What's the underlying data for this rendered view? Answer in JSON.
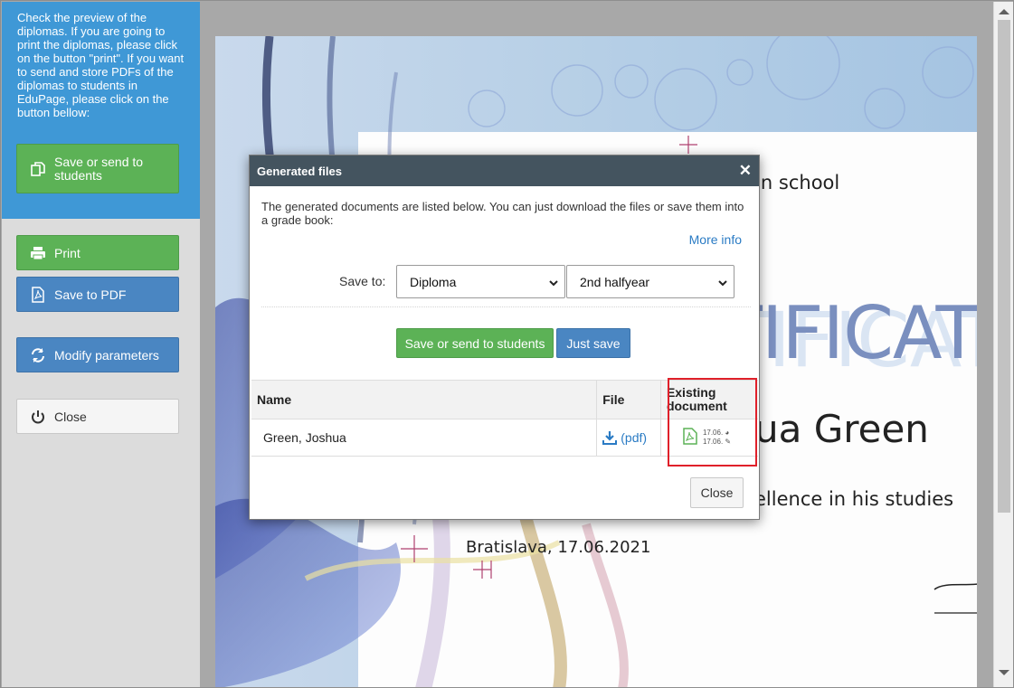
{
  "sidebar": {
    "instructions": "Check the preview of the diplomas. If you are going to print the diplomas, please click on the button \"print\". If you want to send and store PDFs of the diplomas to students in EduPage, please click on the button bellow:",
    "save_send_label": "Save or send to students",
    "print_label": "Print",
    "save_pdf_label": "Save to PDF",
    "modify_label": "Modify parameters",
    "close_label": "Close"
  },
  "certificate": {
    "school_fragment": "en school",
    "title_fragment": "TIFICAT",
    "name_fragment": "ua Green",
    "text_fragment": "ellence in his studies",
    "place_date": "Bratislava, 17.06.2021"
  },
  "modal": {
    "title": "Generated files",
    "description": "The generated documents are listed below. You can just download the files or save them into a grade book:",
    "more_info": "More info",
    "save_to_label": "Save to:",
    "save_to_value": "Diploma",
    "period_value": "2nd halfyear",
    "btn_save_send": "Save or send to students",
    "btn_just_save": "Just save",
    "table": {
      "headers": [
        "Name",
        "File",
        "Existing document"
      ],
      "rows": [
        {
          "name": "Green, Joshua",
          "file": "(pdf)",
          "date1": "17.06.",
          "date2": "17.06."
        }
      ]
    },
    "close_label": "Close"
  },
  "colors": {
    "accent_blue": "#3f98d6",
    "button_green": "#5cb256",
    "button_blue": "#4a86c2",
    "modal_header": "#44545f",
    "highlight_red": "#e0202a"
  }
}
